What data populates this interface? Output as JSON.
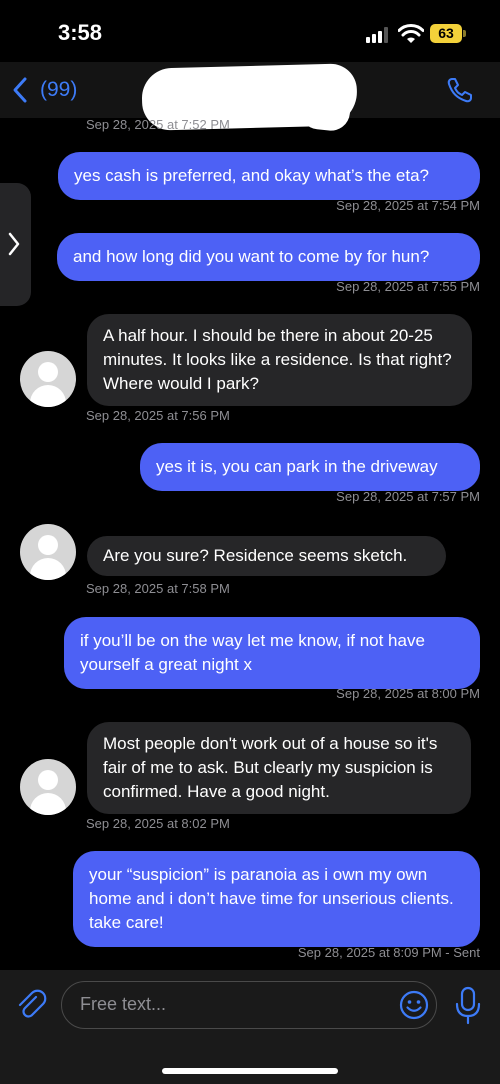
{
  "status_bar": {
    "time": "3:58",
    "battery": "63"
  },
  "nav": {
    "back_count": "(99)"
  },
  "composer": {
    "placeholder": "Free text..."
  },
  "colors": {
    "outgoing_bubble": "#4d61f5",
    "incoming_bubble": "#262628",
    "accent": "#3d7bf7",
    "background": "#000000"
  },
  "icons": [
    "back-chevron-icon",
    "phone-icon",
    "side-handle-chevron-icon",
    "avatar-placeholder-icon",
    "paperclip-icon",
    "emoji-icon",
    "microphone-icon"
  ],
  "messages": [
    {
      "direction": "incoming",
      "text": "",
      "timestamp": "Sep 28, 2025 at 7:52 PM"
    },
    {
      "direction": "outgoing",
      "text": "yes cash is preferred, and okay what’s the eta?",
      "timestamp": "Sep 28, 2025 at 7:54 PM"
    },
    {
      "direction": "outgoing",
      "text": "and how long did you want to come by for hun?",
      "timestamp": "Sep 28, 2025 at 7:55 PM"
    },
    {
      "direction": "incoming",
      "text": "A half hour. I should be there in about 20-25 minutes. It looks like a residence. Is that right? Where would I park?",
      "timestamp": "Sep 28, 2025 at 7:56 PM"
    },
    {
      "direction": "outgoing",
      "text": "yes it is, you can park in the driveway",
      "timestamp": "Sep 28, 2025 at 7:57 PM"
    },
    {
      "direction": "incoming",
      "text": "Are you sure? Residence seems sketch.",
      "timestamp": "Sep 28, 2025 at 7:58 PM"
    },
    {
      "direction": "outgoing",
      "text": "if you’ll be on the way let me know, if not have yourself a great night x",
      "timestamp": "Sep 28, 2025 at 8:00 PM"
    },
    {
      "direction": "incoming",
      "text": "Most people don't work out of a house so it's fair of me to ask. But clearly my suspicion is confirmed. Have a good night.",
      "timestamp": "Sep 28, 2025 at 8:02 PM"
    },
    {
      "direction": "outgoing",
      "text": "your “suspicion” is paranoia as i own my own home and i don’t have time for unserious clients. take care!",
      "timestamp": "Sep 28, 2025 at 8:09 PM - Sent"
    }
  ]
}
